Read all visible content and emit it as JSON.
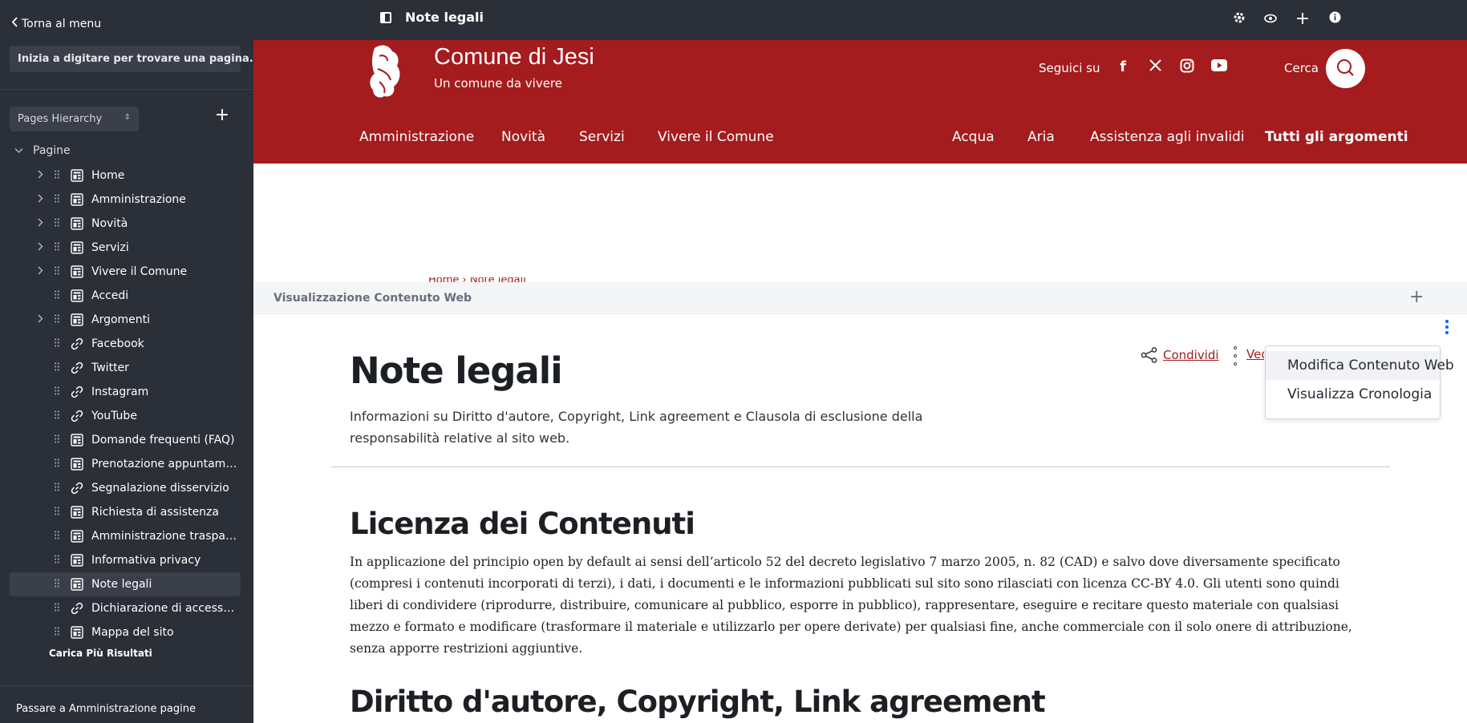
{
  "sidebar": {
    "back_label": "Torna al menu",
    "search_placeholder": "Inizia a digitare per trovare una pagina.",
    "hierarchy_select": "Pages Hierarchy",
    "root_label": "Pagine",
    "items": [
      {
        "label": "Home",
        "icon": "page-icon",
        "expandable": true
      },
      {
        "label": "Amministrazione",
        "icon": "page-icon",
        "expandable": true
      },
      {
        "label": "Novità",
        "icon": "page-icon",
        "expandable": true
      },
      {
        "label": "Servizi",
        "icon": "page-icon",
        "expandable": true
      },
      {
        "label": "Vivere il Comune",
        "icon": "page-icon",
        "expandable": true
      },
      {
        "label": "Accedi",
        "icon": "page-icon",
        "expandable": false
      },
      {
        "label": "Argomenti",
        "icon": "page-icon",
        "expandable": true
      },
      {
        "label": "Facebook",
        "icon": "link-icon",
        "expandable": false
      },
      {
        "label": "Twitter",
        "icon": "link-icon",
        "expandable": false
      },
      {
        "label": "Instagram",
        "icon": "link-icon",
        "expandable": false
      },
      {
        "label": "YouTube",
        "icon": "link-icon",
        "expandable": false
      },
      {
        "label": "Domande frequenti (FAQ)",
        "icon": "page-icon",
        "expandable": false
      },
      {
        "label": "Prenotazione appuntamento",
        "icon": "page-icon",
        "expandable": false
      },
      {
        "label": "Segnalazione disservizio",
        "icon": "link-icon",
        "expandable": false
      },
      {
        "label": "Richiesta di assistenza",
        "icon": "page-icon",
        "expandable": false
      },
      {
        "label": "Amministrazione trasparente",
        "icon": "page-icon",
        "expandable": false
      },
      {
        "label": "Informativa privacy",
        "icon": "page-icon",
        "expandable": false
      },
      {
        "label": "Note legali",
        "icon": "page-icon",
        "expandable": false,
        "selected": true
      },
      {
        "label": "Dichiarazione di accessibilità",
        "icon": "link-icon",
        "expandable": false
      },
      {
        "label": "Mappa del sito",
        "icon": "page-icon",
        "expandable": false
      }
    ],
    "load_more": "Carica Più Risultati",
    "admin_link": "Passare a Amministrazione pagine"
  },
  "topbar": {
    "page_title": "Note legali"
  },
  "site_header": {
    "name": "Comune di Jesi",
    "tagline": "Un comune da vivere",
    "follow_label": "Seguici su",
    "search_label": "Cerca",
    "nav_left": [
      "Amministrazione",
      "Novità",
      "Servizi",
      "Vivere il Comune"
    ],
    "nav_right": [
      "Acqua",
      "Aria",
      "Assistenza agli invalidi",
      "Tutti gli argomenti"
    ]
  },
  "portlet": {
    "title": "Visualizzazione Contenuto Web"
  },
  "article": {
    "breadcrumb_peek": "Home  ›  Note legali",
    "title": "Note legali",
    "lead": "Informazioni su Diritto d'autore, Copyright, Link agreement e Clausola di esclusione della responsabilità relative al sito web.",
    "share_label": "Condividi",
    "view_label": "Vedi azioni",
    "section1_title": "Licenza dei Contenuti",
    "section1_body": "In applicazione del principio open by default ai sensi dell’articolo 52 del decreto legislativo 7 marzo 2005, n. 82 (CAD) e salvo dove diversamente specificato (compresi i contenuti incorporati di terzi), i dati, i documenti e le informazioni pubblicati sul sito sono rilasciati con licenza CC-BY 4.0. Gli utenti sono quindi liberi di condividere (riprodurre, distribuire, comunicare al pubblico, esporre in pubblico), rappresentare, eseguire e recitare questo materiale con qualsiasi mezzo e formato e modificare (trasformare il materiale e utilizzarlo per opere derivate) per qualsiasi fine, anche commerciale con il solo onere di attribuzione, senza apporre restrizioni aggiuntive.",
    "section2_title": "Diritto d'autore, Copyright, Link agreement"
  },
  "dropdown": {
    "items": [
      "Modifica Contenuto Web",
      "Visualizza Cronologia"
    ]
  },
  "colors": {
    "sidebar_bg": "#2b2f38",
    "brand_red": "#a41c1e",
    "accent_blue": "#0b5fff"
  }
}
